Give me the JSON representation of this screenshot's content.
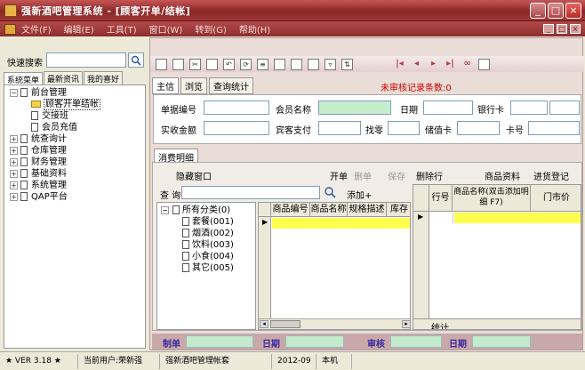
{
  "window": {
    "title": "强新酒吧管理系统 - [顾客开单/结帐]"
  },
  "menu": {
    "items": [
      "文件(F)",
      "编辑(E)",
      "工具(T)",
      "窗口(W)",
      "转到(G)",
      "帮助(H)"
    ]
  },
  "left": {
    "quick_search_label": "快速搜索",
    "tabs": [
      "系统菜单",
      "最新资讯",
      "我的喜好"
    ],
    "tree": [
      {
        "label": "前台管理",
        "expanded": true,
        "children": [
          "顾客开单结帐",
          "交接班",
          "会员充值"
        ],
        "selected_child": 0
      },
      {
        "label": "统查询计"
      },
      {
        "label": "仓库管理"
      },
      {
        "label": "财务管理"
      },
      {
        "label": "基础资料"
      },
      {
        "label": "系统管理"
      },
      {
        "label": "QAP平台"
      }
    ]
  },
  "main": {
    "tabs": [
      "主信",
      "浏览",
      "查询统计"
    ],
    "unreviewed_label": "未审核记录条数:0",
    "form": {
      "bill_no": "单据编号",
      "member_name": "会员名称",
      "date": "日期",
      "bank_card": "银行卡",
      "amount_received": "实收金额",
      "guest_payment": "宾客支付",
      "change": "找零",
      "stored_card": "储值卡",
      "card_no": "卡号"
    },
    "detail": {
      "tab": "消费明细",
      "hide_window": "隐藏窗口",
      "open_bill": "开单",
      "delete": "删单",
      "save": "保存",
      "delete_row": "删除行",
      "product_info": "商品资料",
      "purchase_entry": "进货登记",
      "query_label": "查 询",
      "add": "添加+",
      "categories": [
        "所有分类(0)",
        "套餐(001)",
        "烟酒(002)",
        "饮料(003)",
        "小食(004)",
        "其它(005)"
      ],
      "grid1_headers": [
        "商品编号",
        "商品名称",
        "规格描述",
        "库存"
      ],
      "grid2_headers": [
        "行号",
        "商品名称(双击添加明细 F7)",
        "门市价"
      ],
      "total_label": "统计"
    },
    "sign": {
      "maker": "制单",
      "date1": "日期",
      "review": "审核",
      "date2": "日期"
    }
  },
  "status": {
    "version": "★ VER 3.18 ★",
    "current_user": "当前用户:荣新强",
    "company": "强新酒吧管理帐套",
    "period": "2012-09",
    "location": "本机"
  }
}
